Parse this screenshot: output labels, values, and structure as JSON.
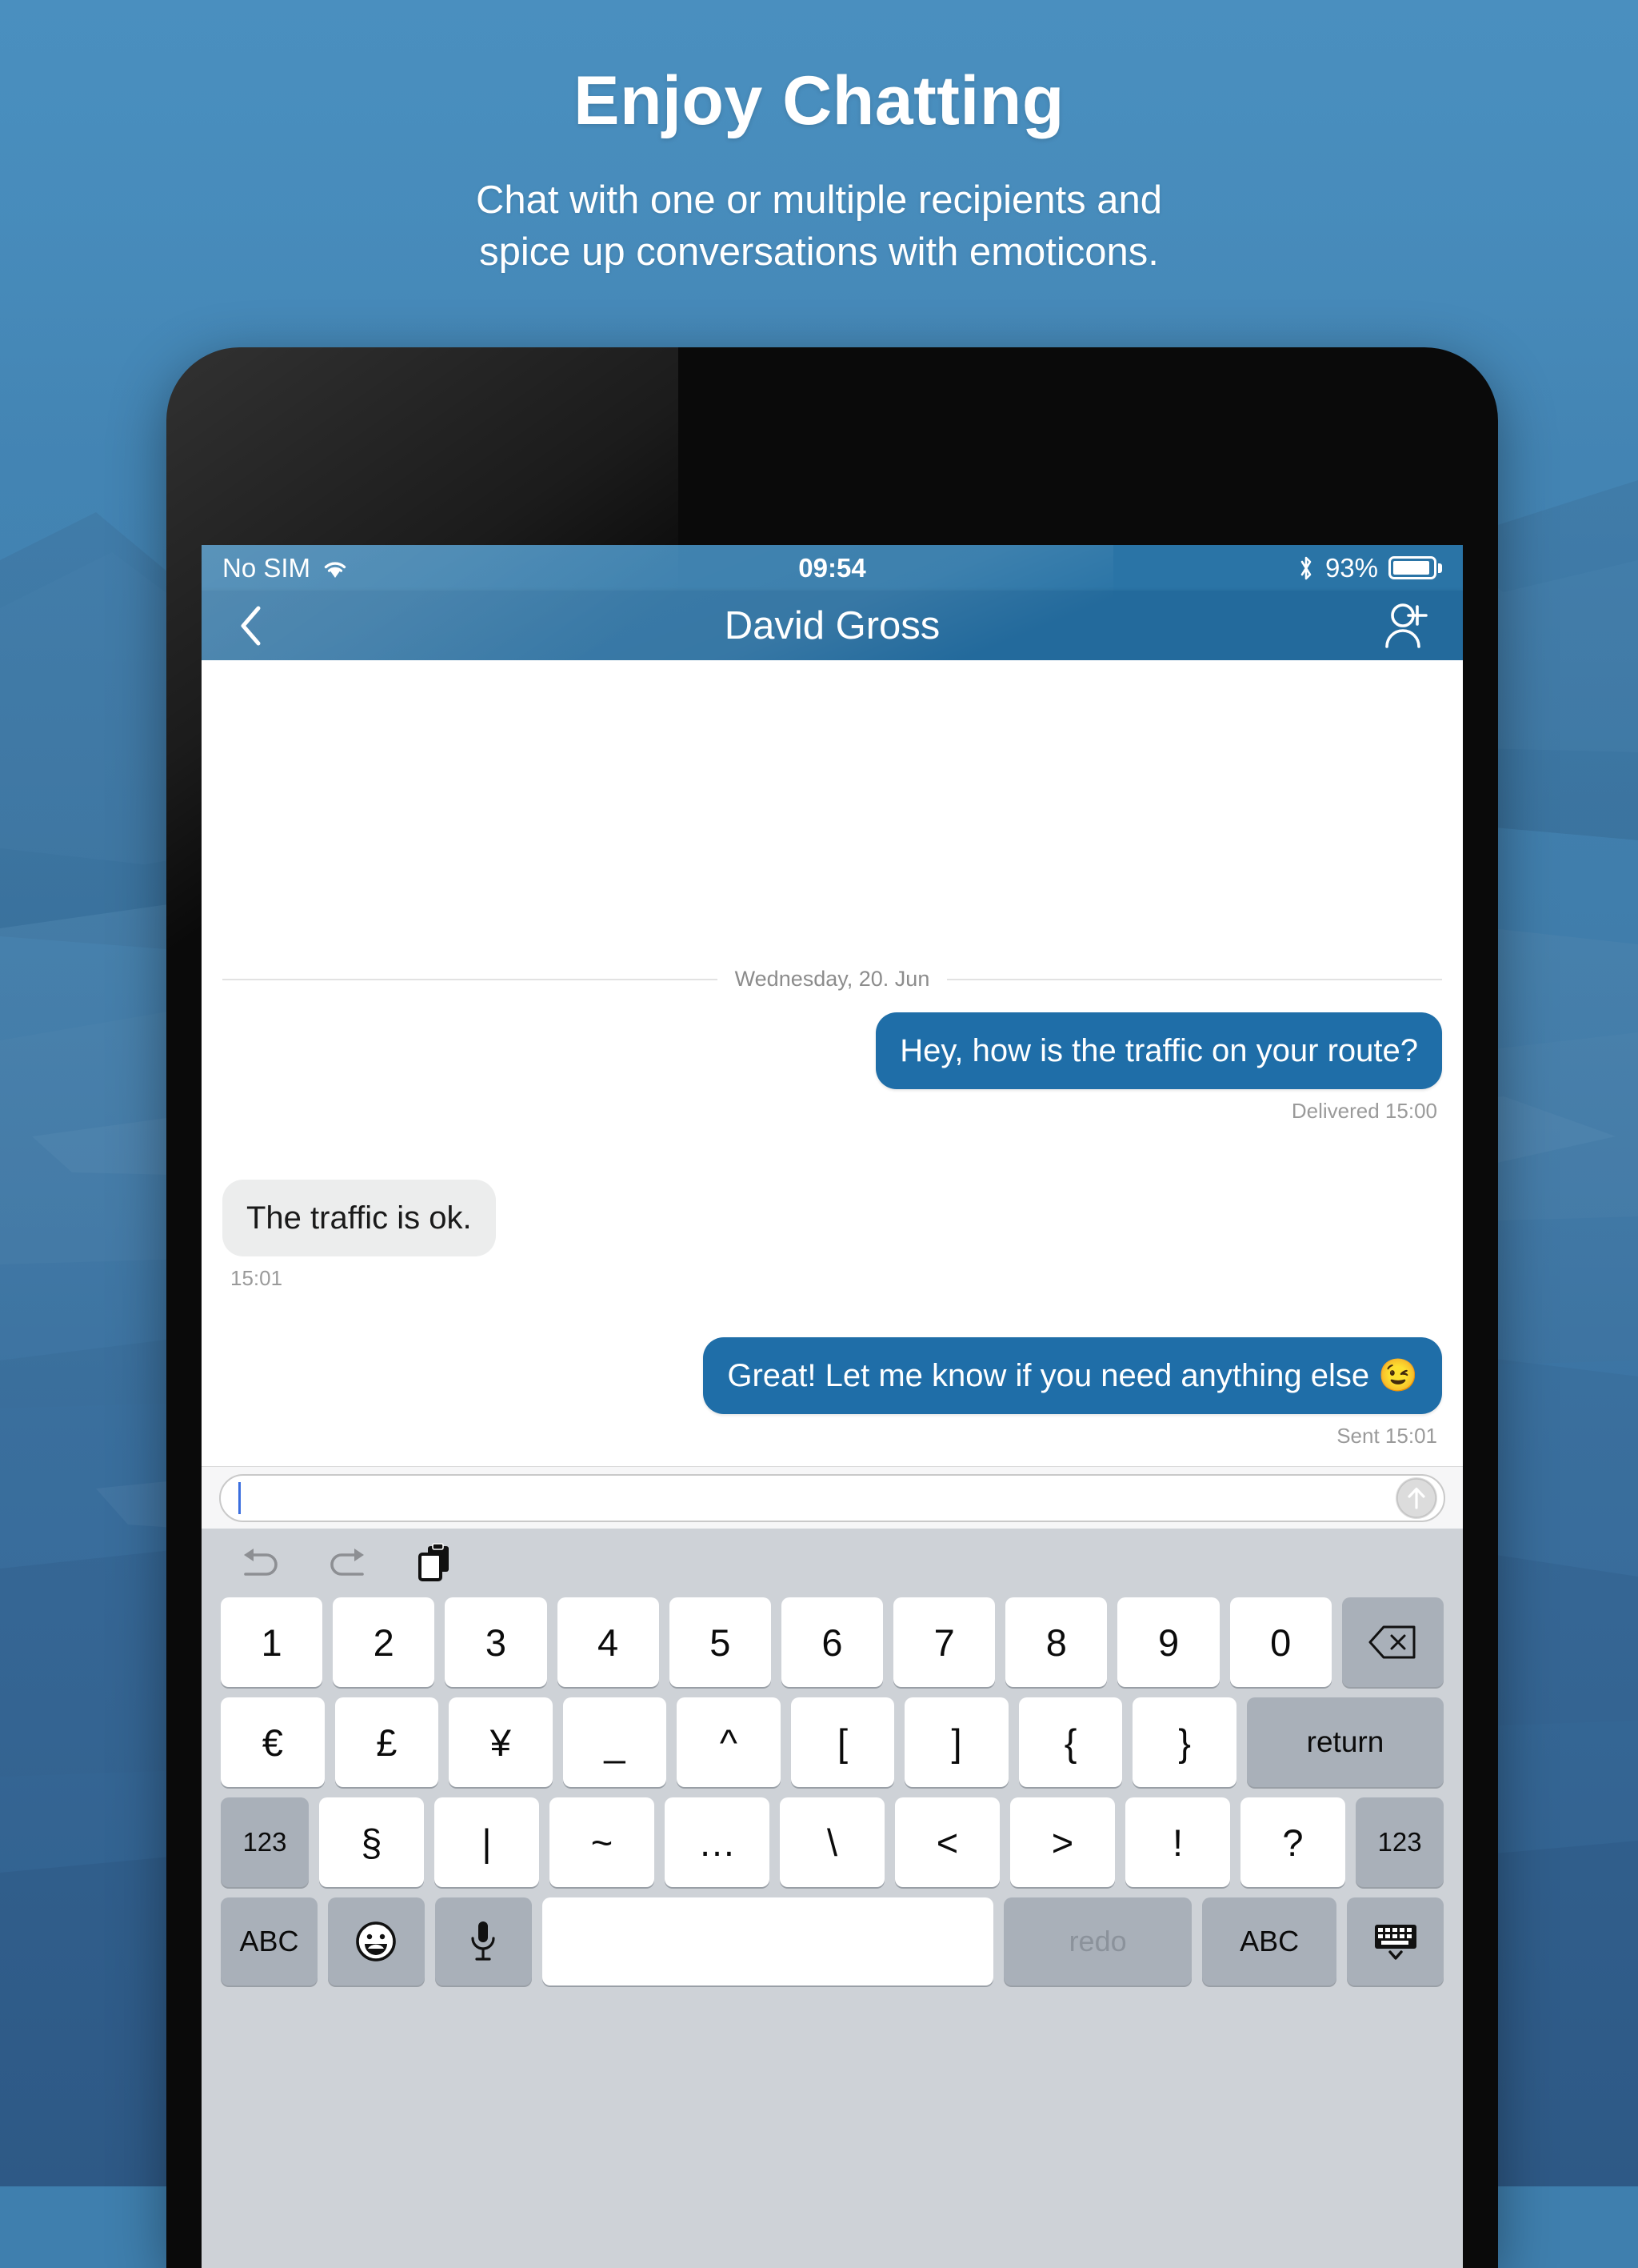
{
  "promo": {
    "title": "Enjoy Chatting",
    "subtitle_line1": "Chat with one or multiple recipients and",
    "subtitle_line2": "spice up conversations with emoticons."
  },
  "colors": {
    "brand_blue": "#236a9c",
    "status_bar_blue": "#2a74a6",
    "sent_bubble": "#1f6ea8",
    "received_bubble": "#eceded",
    "keyboard_bg": "#ced2d7",
    "page_bg": "#3f7fae"
  },
  "status_bar": {
    "carrier": "No SIM",
    "wifi_icon": "wifi-icon",
    "time": "09:54",
    "bluetooth_icon": "bluetooth-icon",
    "battery_percent": "93%",
    "battery_level": 93
  },
  "nav_bar": {
    "back_icon": "chevron-left-icon",
    "title": "David Gross",
    "add_contact_icon": "add-person-icon"
  },
  "chat": {
    "date_separator": "Wednesday, 20. Jun",
    "messages": [
      {
        "direction": "out",
        "text": "Hey, how is the traffic on your route?",
        "meta": "Delivered 15:00"
      },
      {
        "direction": "in",
        "text": "The traffic is ok.",
        "meta": "15:01"
      },
      {
        "direction": "out",
        "text": "Great! Let me know if you need anything else 😉",
        "meta": "Sent 15:01"
      }
    ]
  },
  "composer": {
    "value": "",
    "placeholder": "",
    "send_icon": "arrow-up-circle-icon"
  },
  "keyboard": {
    "toolbar": [
      {
        "name": "undo-icon",
        "label": "undo",
        "enabled": false
      },
      {
        "name": "redo-icon",
        "label": "redo",
        "enabled": false
      },
      {
        "name": "paste-icon",
        "label": "paste",
        "enabled": true
      }
    ],
    "row1": [
      "1",
      "2",
      "3",
      "4",
      "5",
      "6",
      "7",
      "8",
      "9",
      "0"
    ],
    "row1_backspace_icon": "backspace-icon",
    "row2": [
      "€",
      "£",
      "¥",
      "_",
      "^",
      "[",
      "]",
      "{",
      "}"
    ],
    "row2_return": "return",
    "row3_left": "123",
    "row3": [
      "§",
      "|",
      "~",
      "…",
      "\\",
      "<",
      ">",
      "!",
      "?"
    ],
    "row3_right": "123",
    "row4": {
      "abc_left": "ABC",
      "emoji_icon": "emoji-icon",
      "mic_icon": "microphone-icon",
      "space": "",
      "redo": "redo",
      "abc_right": "ABC",
      "hide_keyboard_icon": "hide-keyboard-icon"
    }
  }
}
